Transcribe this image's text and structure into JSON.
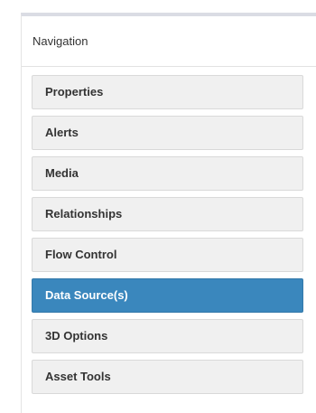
{
  "navigation": {
    "heading": "Navigation",
    "active_color": "#3a87bd",
    "items": [
      {
        "label": "Properties",
        "active": false
      },
      {
        "label": "Alerts",
        "active": false
      },
      {
        "label": "Media",
        "active": false
      },
      {
        "label": "Relationships",
        "active": false
      },
      {
        "label": "Flow Control",
        "active": false
      },
      {
        "label": "Data Source(s)",
        "active": true
      },
      {
        "label": "3D Options",
        "active": false
      },
      {
        "label": "Asset Tools",
        "active": false
      }
    ]
  }
}
